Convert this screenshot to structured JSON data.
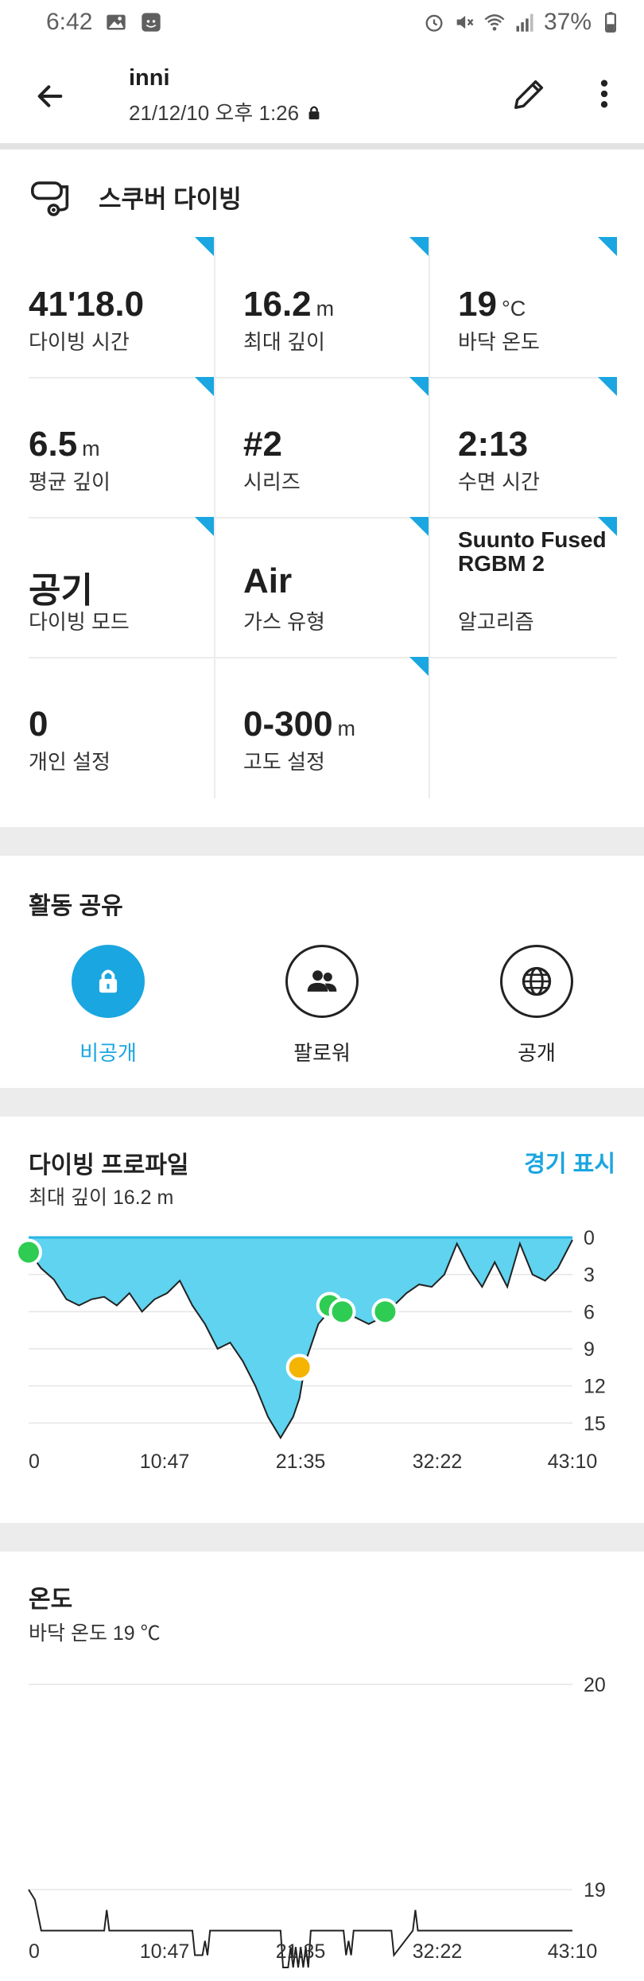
{
  "status_bar": {
    "time": "6:42",
    "battery": "37%",
    "icons": [
      "gallery-icon",
      "app-icon",
      "alarm-icon",
      "mute-icon",
      "wifi-icon",
      "signal-icon",
      "battery-icon"
    ]
  },
  "app_bar": {
    "title": "inni",
    "subtitle": "21/12/10 오후 1:26",
    "icons": [
      "back-arrow-icon",
      "lock-icon",
      "edit-pencil-icon",
      "more-vert-icon"
    ]
  },
  "activity": {
    "type_label": "스쿠버 다이빙",
    "icon": "scuba-mask-icon"
  },
  "stats": [
    {
      "value": "41'18.0",
      "unit": "",
      "label": "다이빙 시간"
    },
    {
      "value": "16.2",
      "unit": "m",
      "label": "최대 깊이"
    },
    {
      "value": "19",
      "unit": "°C",
      "label": "바닥 온도"
    },
    {
      "value": "6.5",
      "unit": "m",
      "label": "평균 깊이"
    },
    {
      "value": "#2",
      "unit": "",
      "label": "시리즈"
    },
    {
      "value": "2:13",
      "unit": "",
      "label": "수면 시간"
    },
    {
      "value": "공기",
      "unit": "",
      "label": "다이빙 모드"
    },
    {
      "value": "Air",
      "unit": "",
      "label": "가스 유형"
    },
    {
      "value": "Suunto Fused RGBM 2",
      "unit": "",
      "label": "알고리즘"
    },
    {
      "value": "0",
      "unit": "",
      "label": "개인 설정"
    },
    {
      "value": "0-300",
      "unit": "m",
      "label": "고도 설정"
    }
  ],
  "share": {
    "title": "활동 공유",
    "options": [
      {
        "label": "비공개",
        "icon": "lock-icon",
        "selected": true
      },
      {
        "label": "팔로워",
        "icon": "people-icon",
        "selected": false
      },
      {
        "label": "공개",
        "icon": "globe-icon",
        "selected": false
      }
    ]
  },
  "accent_color": "#1aa6e0",
  "chart_data": [
    {
      "type": "area",
      "title": "다이빙 프로파일",
      "subtitle": "최대 깊이 16.2 m",
      "link_label": "경기 표시",
      "x_tick_labels": [
        "0",
        "10:47",
        "21:35",
        "32:22",
        "43:10"
      ],
      "y_tick_labels": [
        "0",
        "3",
        "6",
        "9",
        "12",
        "15"
      ],
      "xlim": [
        0,
        43.17
      ],
      "ylim": [
        0,
        16.2
      ],
      "y_inverted": true,
      "fill_color": "#5fd3ef",
      "x": [
        0,
        0.5,
        1,
        2,
        3,
        4,
        5,
        6,
        7,
        8,
        9,
        10,
        11,
        12,
        13,
        14,
        15,
        16,
        17,
        18,
        19,
        20,
        21,
        21.5,
        22,
        23,
        24,
        25,
        26,
        27,
        28,
        29,
        30,
        31,
        32,
        33,
        34,
        35,
        36,
        37,
        38,
        39,
        40,
        41,
        42,
        43.17
      ],
      "values": [
        0.8,
        1.8,
        2.5,
        3.4,
        5.0,
        5.5,
        5.0,
        4.8,
        5.5,
        4.5,
        6.0,
        5.0,
        4.5,
        3.5,
        5.5,
        7.0,
        9.0,
        8.5,
        10.0,
        12.0,
        14.5,
        16.2,
        14.5,
        13.0,
        10.0,
        7.0,
        5.8,
        6.0,
        6.5,
        7.0,
        6.5,
        5.5,
        4.5,
        3.8,
        4.0,
        3.0,
        0.5,
        2.5,
        4.0,
        2.0,
        4.0,
        0.5,
        3.0,
        3.5,
        2.5,
        0.2
      ],
      "markers": [
        {
          "x": 0,
          "y": 1.2,
          "color": "#2ecc52"
        },
        {
          "x": 21.5,
          "y": 10.5,
          "color": "#f5b400"
        },
        {
          "x": 23.9,
          "y": 5.5,
          "color": "#2ecc52"
        },
        {
          "x": 24.9,
          "y": 6.0,
          "color": "#2ecc52"
        },
        {
          "x": 28.3,
          "y": 6.0,
          "color": "#2ecc52"
        }
      ]
    },
    {
      "type": "line",
      "title": "온도",
      "subtitle": "바닥 온도 19 ℃",
      "x_tick_labels": [
        "0",
        "10:47",
        "21:35",
        "32:22",
        "43:10"
      ],
      "y_tick_labels": [
        "20",
        "19"
      ],
      "xlim": [
        0,
        43.17
      ],
      "ylim": [
        18.6,
        20
      ],
      "line_color": "#222222",
      "x": [
        0,
        0.5,
        1,
        5,
        6,
        6.2,
        6.4,
        13,
        13.2,
        13.8,
        14,
        14.2,
        14.4,
        20,
        20.2,
        20.6,
        20.8,
        21,
        21.2,
        21.4,
        21.6,
        21.8,
        22,
        22.2,
        22.4,
        25,
        25.2,
        25.4,
        25.6,
        25.8,
        28.8,
        29,
        30.5,
        30.7,
        30.9,
        43.17
      ],
      "values": [
        19.0,
        18.95,
        18.8,
        18.8,
        18.8,
        18.9,
        18.8,
        18.8,
        18.68,
        18.68,
        18.75,
        18.68,
        18.8,
        18.8,
        18.62,
        18.62,
        18.72,
        18.62,
        18.72,
        18.62,
        18.72,
        18.62,
        18.72,
        18.62,
        18.8,
        18.8,
        18.68,
        18.75,
        18.68,
        18.8,
        18.8,
        18.68,
        18.8,
        18.9,
        18.8,
        18.8
      ]
    }
  ]
}
